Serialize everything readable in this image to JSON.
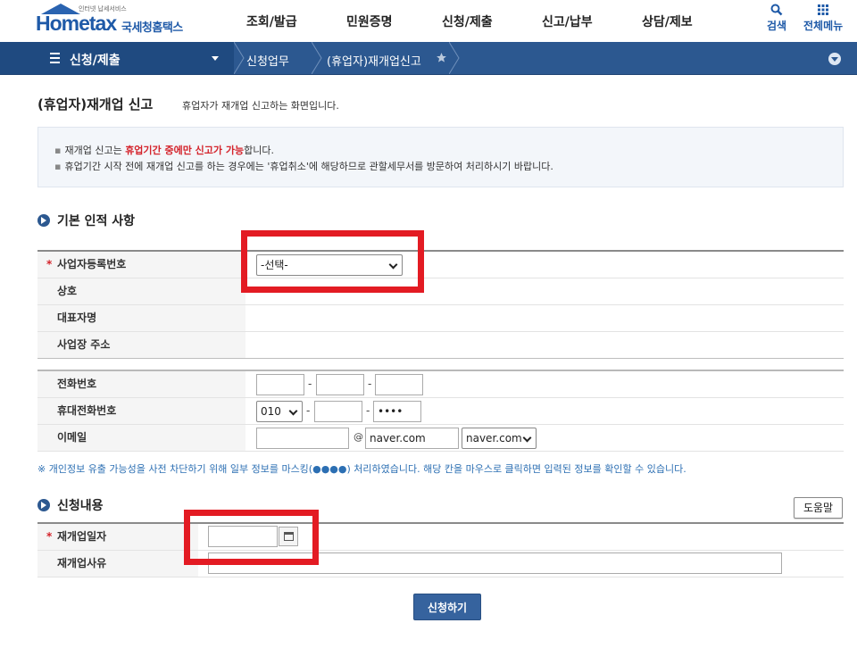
{
  "header": {
    "logo_small": "인터넷 납세서비스",
    "logo_home": "Hometax",
    "logo_kr": "국세청홈택스",
    "gnb": [
      "조회/발급",
      "민원증명",
      "신청/제출",
      "신고/납부",
      "상담/제보"
    ],
    "search_label": "검색",
    "allmenu_label": "전체메뉴"
  },
  "nav": {
    "menu_title": "신청/제출",
    "crumbs": [
      "신청업무",
      "(휴업자)재개업신고"
    ]
  },
  "page": {
    "title": "(휴업자)재개업 신고",
    "desc": "휴업자가 재개업 신고하는 화면입니다."
  },
  "notice": {
    "line1_pre": "재개업 신고는 ",
    "line1_red": "휴업기간 중에만 신고가 가능",
    "line1_post": "합니다.",
    "line2": "휴업기간 시작 전에 재개업 신고를 하는 경우에는 '휴업취소'에 해당하므로 관할세무서를 방문하여 처리하시기 바랍니다."
  },
  "basic": {
    "heading": "기본 인적 사항",
    "bizno_label": "사업자등록번호",
    "bizno_value": "-선택-",
    "name_label": "상호",
    "ceo_label": "대표자명",
    "addr_label": "사업장 주소",
    "phone_label": "전화번호",
    "mobile_label": "휴대전화번호",
    "mobile_prefix": "010",
    "mobile_last": "••••",
    "email_label": "이메일",
    "email_at": "@",
    "email_domain": "naver.com",
    "email_select": "naver.com",
    "dash": "-"
  },
  "privacy": "※ 개인정보 유출 가능성을 사전 차단하기 위해 일부 정보를 마스킹(●●●●) 처리하였습니다. 해당 칸을 마우스로 클릭하면 입력된 정보를 확인할 수 있습니다.",
  "request": {
    "heading": "신청내용",
    "help": "도움말",
    "date_label": "재개업일자",
    "reason_label": "재개업사유",
    "submit": "신청하기"
  },
  "colors": {
    "brand": "#1f5aa8",
    "nav": "#2c5890",
    "highlight": "#e31b23",
    "notice_red": "#d4232b"
  }
}
